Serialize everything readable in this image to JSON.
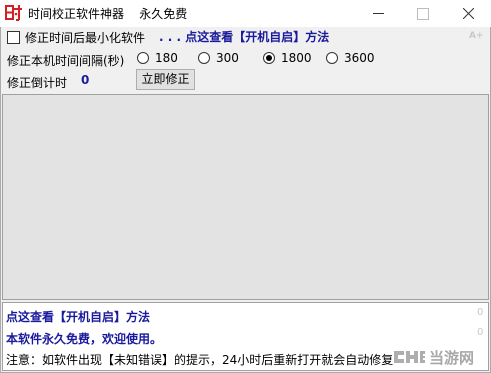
{
  "window": {
    "title": "时间校正软件神器    永久免费",
    "minimize_glyph": "",
    "close_glyph": ""
  },
  "options": {
    "minimize_after_fix_label": "修正时间后最小化软件",
    "tip_link": ". . . 点这查看【开机自启】方法",
    "ap_mark": "A+"
  },
  "interval": {
    "label": "修正本机时间间隔(秒)",
    "choices": [
      "180",
      "300",
      "1800",
      "3600"
    ],
    "selected": "1800"
  },
  "countdown": {
    "label": "修正倒计时",
    "value": "0",
    "fix_now_button": "立即修正"
  },
  "messages": {
    "line1": "点这查看【开机自启】方法",
    "line2": "本软件永久免费，欢迎使用。",
    "line3": "注意：如软件出现【未知错误】的提示，24小时后重新打开就会自动修复",
    "counter1": "0",
    "counter2": "0"
  },
  "watermark": {
    "text": "当游网"
  },
  "colors": {
    "link_blue": "#1a1a9c",
    "icon_red": "#d31f26"
  }
}
